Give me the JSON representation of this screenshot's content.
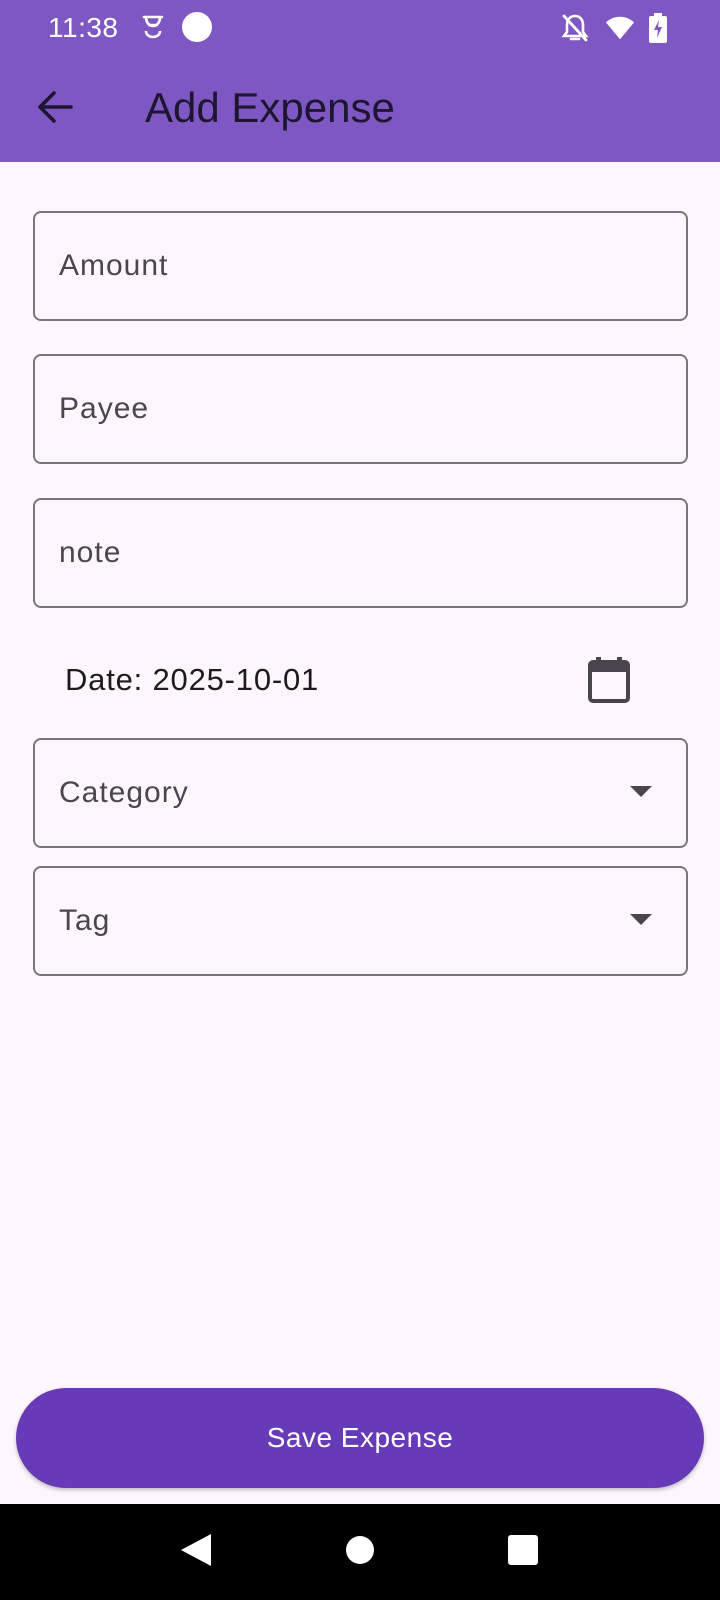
{
  "status_bar": {
    "time": "11:38",
    "left_icons": [
      "notification-app-icon",
      "circle-icon"
    ],
    "right_icons": [
      "notifications-off-icon",
      "wifi-icon",
      "battery-charging-icon"
    ]
  },
  "app_bar": {
    "back_icon": "arrow-back-icon",
    "title": "Add Expense"
  },
  "form": {
    "amount": {
      "placeholder": "Amount",
      "value": ""
    },
    "payee": {
      "placeholder": "Payee",
      "value": ""
    },
    "note": {
      "placeholder": "note",
      "value": ""
    },
    "date_label": "Date: 2025-10-01",
    "calendar_icon": "calendar-icon",
    "category": {
      "label": "Category",
      "icon": "dropdown-arrow-icon"
    },
    "tag": {
      "label": "Tag",
      "icon": "dropdown-arrow-icon"
    }
  },
  "save_button": {
    "label": "Save Expense"
  },
  "nav_bar": {
    "icons": [
      "nav-back-icon",
      "nav-home-icon",
      "nav-recents-icon"
    ]
  },
  "colors": {
    "app_bar": "#7e57c2",
    "primary_button": "#673ab7",
    "background": "#fdf7fd",
    "outline": "#7a747c",
    "nav_bar": "#000000"
  }
}
